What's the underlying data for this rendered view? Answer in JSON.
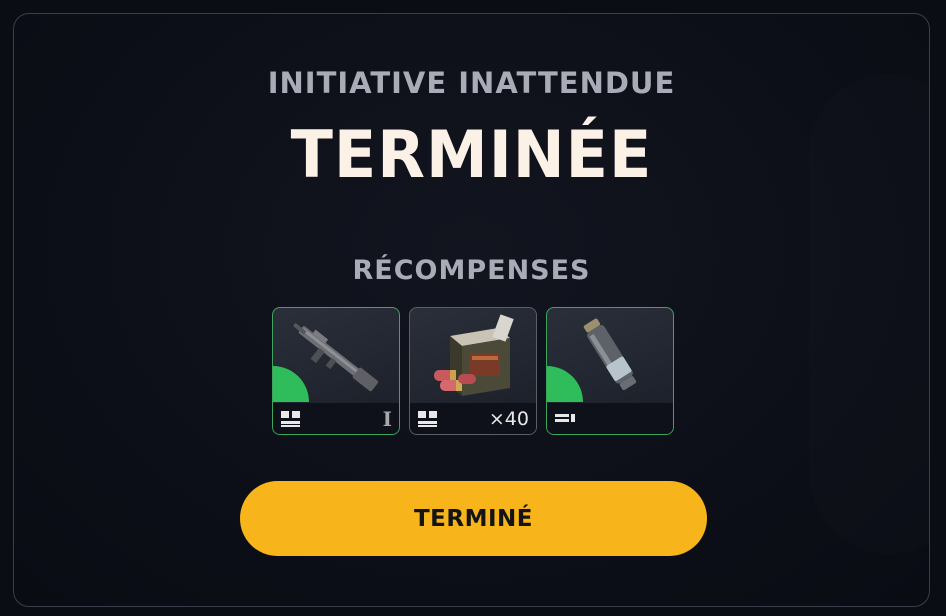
{
  "dialog": {
    "subtitle": "INITIATIVE INATTENDUE",
    "title": "TERMINÉE",
    "rewards_label": "RÉCOMPENSES"
  },
  "rewards": [
    {
      "item": "rifle",
      "rarity": "uncommon",
      "slot_icon": "two-slot-icon",
      "tier": "I",
      "quantity": ""
    },
    {
      "item": "shotgun-shells-box",
      "rarity": "common",
      "slot_icon": "two-slot-icon",
      "tier": "",
      "quantity": "×40"
    },
    {
      "item": "canister",
      "rarity": "uncommon",
      "slot_icon": "single-slot-icon",
      "tier": "",
      "quantity": ""
    }
  ],
  "button": {
    "label": "TERMINÉ"
  },
  "colors": {
    "accent": "#f7b51b",
    "uncommon": "#2fbd5c",
    "title": "#fbf1e6",
    "subtitle": "#a9acb7"
  }
}
